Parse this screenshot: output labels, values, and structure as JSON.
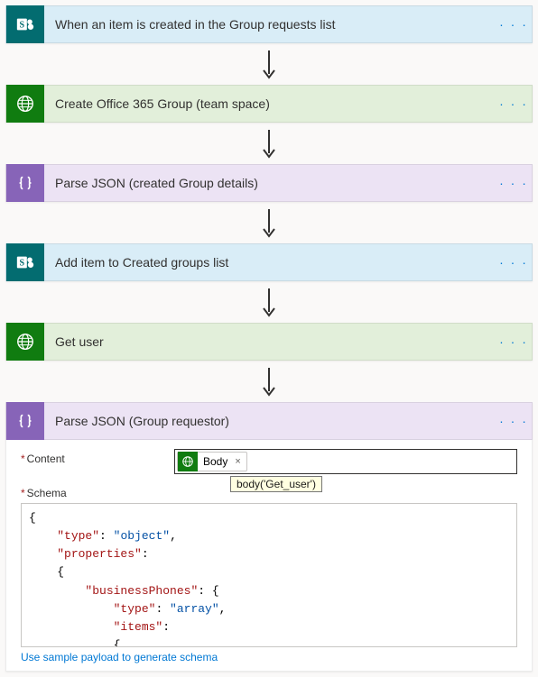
{
  "steps": [
    {
      "kind": "sharepoint",
      "icon": "sharepoint-icon",
      "title": "When an item is created in the Group requests list"
    },
    {
      "kind": "http",
      "icon": "globe-icon",
      "title": "Create Office 365 Group (team space)"
    },
    {
      "kind": "dataop",
      "icon": "dataop-icon",
      "title": "Parse JSON (created Group details)"
    },
    {
      "kind": "sharepoint",
      "icon": "sharepoint-icon",
      "title": "Add item to Created groups list"
    },
    {
      "kind": "http",
      "icon": "globe-icon",
      "title": "Get user"
    },
    {
      "kind": "dataop",
      "icon": "dataop-icon",
      "title": "Parse JSON (Group requestor)"
    }
  ],
  "menu_label": "· · ·",
  "details": {
    "content_label": "Content",
    "schema_label": "Schema",
    "required_marker": "*",
    "token_label": "Body",
    "token_close": "×",
    "tooltip_text": "body('Get_user')",
    "schema_json": {
      "type": "object",
      "properties": {
        "businessPhones": {
          "type": "array",
          "items": {
            "type": null
          }
        }
      }
    },
    "sample_link": "Use sample payload to generate schema"
  }
}
